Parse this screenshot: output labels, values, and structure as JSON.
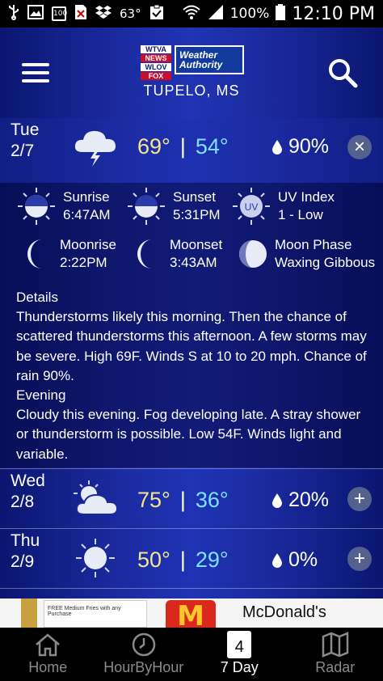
{
  "status_bar": {
    "signal": "63°",
    "battery": "100%",
    "time": "12:10 PM",
    "box_label": "100"
  },
  "header": {
    "logo": {
      "calls": [
        "WTVA",
        "NEWS",
        "WLOV",
        "FOX"
      ],
      "brand": "Weather Authority"
    },
    "city": "TUPELO, MS"
  },
  "days": [
    {
      "day": "Tue",
      "date": "2/7",
      "icon": "thunderstorm-cloud-icon",
      "high": "69°",
      "low": "54°",
      "precip": "90%",
      "toggle": "×"
    },
    {
      "day": "Wed",
      "date": "2/8",
      "icon": "partly-cloudy-icon",
      "high": "75°",
      "low": "36°",
      "precip": "20%",
      "toggle": "+"
    },
    {
      "day": "Thu",
      "date": "2/9",
      "icon": "sunny-icon",
      "high": "50°",
      "low": "29°",
      "precip": "0%",
      "toggle": "+"
    }
  ],
  "separator": "|",
  "astro": {
    "sunrise": {
      "label": "Sunrise",
      "value": "6:47AM"
    },
    "sunset": {
      "label": "Sunset",
      "value": "5:31PM"
    },
    "uv": {
      "label": "UV Index",
      "value": "1 - Low",
      "badge": "UV"
    },
    "moonrise": {
      "label": "Moonrise",
      "value": "2:22PM"
    },
    "moonset": {
      "label": "Moonset",
      "value": "3:43AM"
    },
    "moonphase": {
      "label": "Moon Phase",
      "value": "Waxing Gibbous"
    }
  },
  "details": {
    "title": "Details",
    "day_text": "Thunderstorms likely this morning. Then the chance of scattered thunderstorms this afternoon. A few storms may be severe. High 69F. Winds S at 10 to 20 mph. Chance of rain 90%.",
    "evening_title": "Evening",
    "evening_text": "Cloudy this evening. Fog developing late. A stray shower or thunderstorm is possible. Low 54F. Winds light and variable."
  },
  "ad": {
    "fine_print": "FREE Medium Fries with any Purchase",
    "brand": "McDonald's",
    "logo_letter": "M"
  },
  "nav": {
    "items": [
      {
        "label": "Home"
      },
      {
        "label": "HourByHour"
      },
      {
        "label": "7 Day",
        "badge": "4"
      },
      {
        "label": "Radar"
      }
    ]
  },
  "colors": {
    "high": "#f6e58d",
    "low": "#7fe0ff",
    "background": "#1a2a9e"
  }
}
